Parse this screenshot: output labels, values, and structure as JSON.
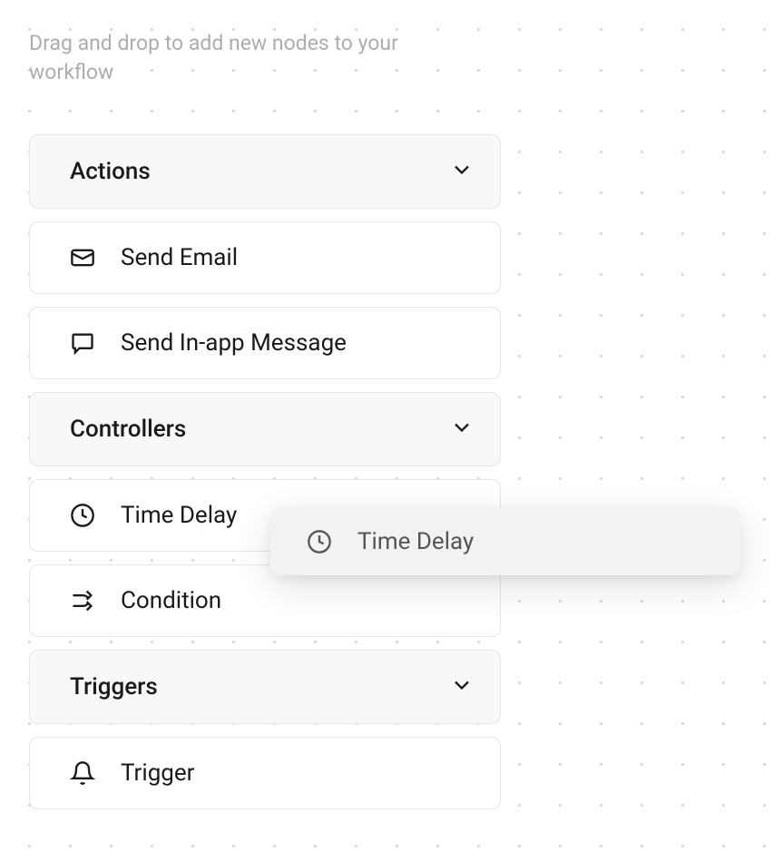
{
  "hint": "Drag and drop to add new nodes to your workflow",
  "groups": {
    "actions": {
      "label": "Actions",
      "items": [
        {
          "label": "Send Email",
          "icon": "mail-icon"
        },
        {
          "label": "Send In-app Message",
          "icon": "message-icon"
        }
      ]
    },
    "controllers": {
      "label": "Controllers",
      "items": [
        {
          "label": "Time Delay",
          "icon": "clock-icon"
        },
        {
          "label": "Condition",
          "icon": "branch-icon"
        }
      ]
    },
    "triggers": {
      "label": "Triggers",
      "items": [
        {
          "label": "Trigger",
          "icon": "bell-icon"
        }
      ]
    }
  },
  "dragging": {
    "label": "Time Delay",
    "icon": "clock-icon"
  }
}
